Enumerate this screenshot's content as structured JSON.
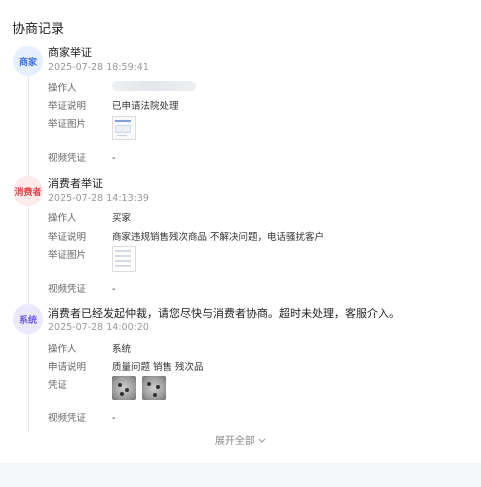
{
  "title": "协商记录",
  "records": [
    {
      "badge": "商家",
      "heading": "商家举证",
      "time": "2025-07-28 18:59:41",
      "operator_label": "操作人",
      "operator_value": "",
      "desc_label": "举证说明",
      "desc_value": "已申请法院处理",
      "images_label": "举证图片",
      "video_label": "视频凭证",
      "video_value": "-"
    },
    {
      "badge": "消费者",
      "heading": "消费者举证",
      "time": "2025-07-28 14:13:39",
      "operator_label": "操作人",
      "operator_value": "买家",
      "desc_label": "举证说明",
      "desc_value": "商家违规销售残次商品 不解决问题，电话骚扰客户",
      "images_label": "举证图片",
      "video_label": "视频凭证",
      "video_value": "-"
    },
    {
      "badge": "系统",
      "heading": "消费者已经发起仲裁，请您尽快与消费者协商。超时未处理，客服介入。",
      "time": "2025-07-28 14:00:20",
      "operator_label": "操作人",
      "operator_value": "系统",
      "desc_label": "申请说明",
      "desc_value": "质量问题 销售 残次品",
      "images_label": "凭证",
      "video_label": "视频凭证",
      "video_value": "-"
    }
  ],
  "expand_label": "展开全部",
  "expand_icon": "chevron-down-icon",
  "colors": {
    "merchant_badge": "#3b6fe3",
    "consumer_badge": "#e0444a",
    "system_badge": "#6c5ce7"
  }
}
